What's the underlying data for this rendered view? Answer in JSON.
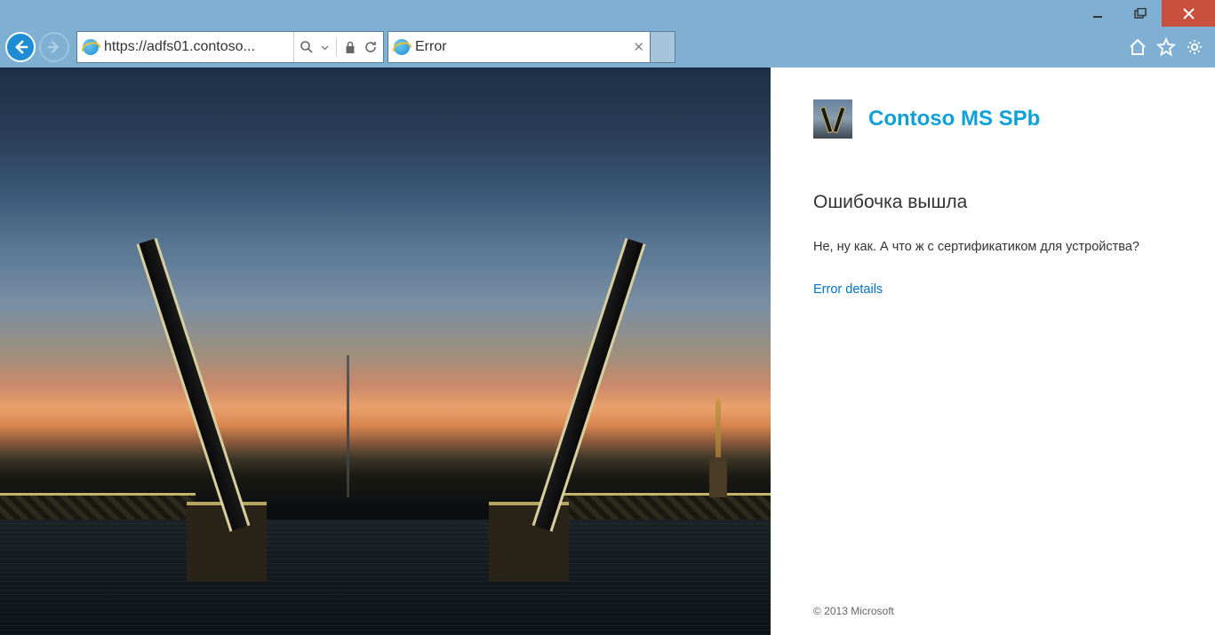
{
  "window": {
    "minimize": "–",
    "maximize": "❐",
    "close": "✕"
  },
  "address": {
    "url": "https://adfs01.contoso..."
  },
  "tab": {
    "title": "Error"
  },
  "page": {
    "brand": "Contoso MS SPb",
    "heading": "Ошибочка вышла",
    "body": "Не, ну как. А что ж с сертификатиком для устройства?",
    "details_link": "Error details",
    "footer": "© 2013 Microsoft"
  }
}
